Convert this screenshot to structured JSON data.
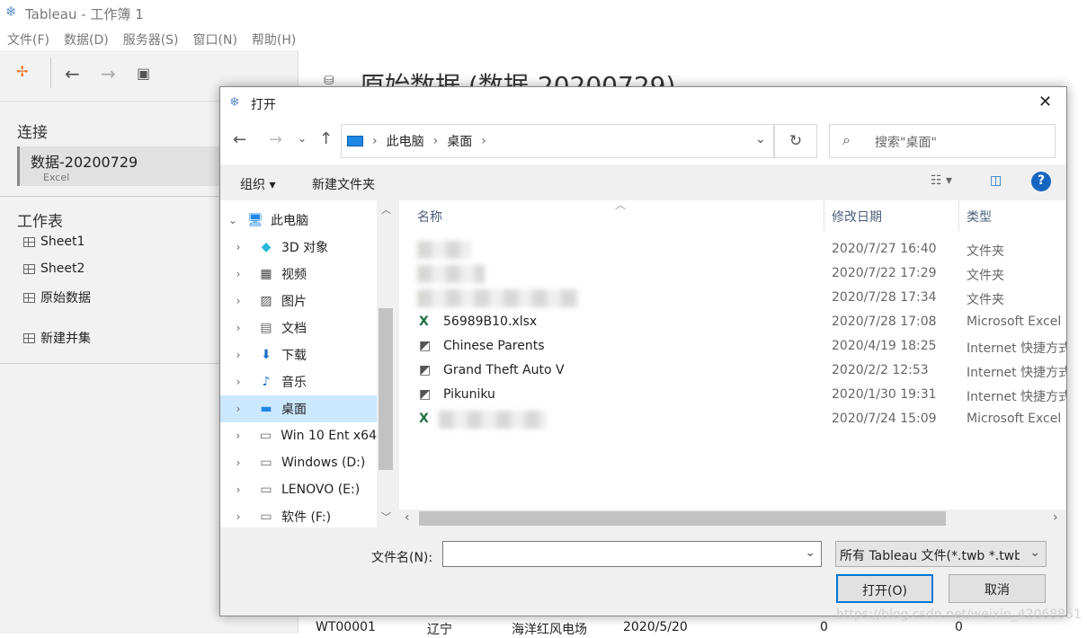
{
  "app": {
    "title": "Tableau - 工作簿 1",
    "menu": [
      "文件(F)",
      "数据(D)",
      "服务器(S)",
      "窗口(N)",
      "帮助(H)"
    ],
    "left": {
      "connections_label": "连接",
      "connection": {
        "name": "数据-20200729",
        "type": "Excel"
      },
      "sheets_label": "工作表",
      "sheets": [
        "Sheet1",
        "Sheet2",
        "原始数据"
      ],
      "new_union": "新建并集"
    },
    "main_title": "原始数据 (数据-20200729)",
    "bg_row": [
      "WT00001",
      "辽宁",
      "海洋红风电场",
      "2020/5/20",
      "0",
      "0"
    ],
    "watermark": "https://blog.csdn.net/weixin_42068851"
  },
  "dialog": {
    "title": "打开",
    "breadcrumb": [
      "此电脑",
      "桌面"
    ],
    "search_placeholder": "搜索\"桌面\"",
    "toolbar": {
      "organize": "组织",
      "new_folder": "新建文件夹"
    },
    "nav": [
      {
        "label": "此电脑",
        "icon": "computer-icon",
        "expanded": true,
        "level": 0
      },
      {
        "label": "3D 对象",
        "icon": "3d-objects-icon",
        "level": 1
      },
      {
        "label": "视频",
        "icon": "video-icon",
        "level": 1
      },
      {
        "label": "图片",
        "icon": "pictures-icon",
        "level": 1
      },
      {
        "label": "文档",
        "icon": "documents-icon",
        "level": 1
      },
      {
        "label": "下载",
        "icon": "download-icon",
        "level": 1
      },
      {
        "label": "音乐",
        "icon": "music-icon",
        "level": 1
      },
      {
        "label": "桌面",
        "icon": "desktop-icon",
        "level": 1,
        "selected": true
      },
      {
        "label": "Win 10 Ent x64",
        "icon": "drive-icon",
        "level": 1
      },
      {
        "label": "Windows (D:)",
        "icon": "drive-icon",
        "level": 1
      },
      {
        "label": "LENOVO (E:)",
        "icon": "drive-icon",
        "level": 1
      },
      {
        "label": "软件 (F:)",
        "icon": "drive-icon",
        "level": 1
      }
    ],
    "columns": [
      "名称",
      "修改日期",
      "类型"
    ],
    "files": [
      {
        "name": "",
        "icon": "folder-icon",
        "date": "2020/7/27 16:40",
        "type": "文件夹",
        "blurred": true
      },
      {
        "name": "",
        "icon": "folder-icon",
        "date": "2020/7/22 17:29",
        "type": "文件夹",
        "blurred": true
      },
      {
        "name": "",
        "icon": "folder-icon",
        "date": "2020/7/28 17:34",
        "type": "文件夹",
        "blurred": true
      },
      {
        "name": "56989B10.xlsx",
        "icon": "excel-icon",
        "date": "2020/7/28 17:08",
        "type": "Microsoft Excel"
      },
      {
        "name": "Chinese Parents",
        "icon": "shortcut-icon",
        "date": "2020/4/19 18:25",
        "type": "Internet 快捷方式"
      },
      {
        "name": "Grand Theft Auto V",
        "icon": "shortcut-icon",
        "date": "2020/2/2 12:53",
        "type": "Internet 快捷方式"
      },
      {
        "name": "Pikuniku",
        "icon": "shortcut-icon",
        "date": "2020/1/30 19:31",
        "type": "Internet 快捷方式"
      },
      {
        "name": "",
        "icon": "excel-icon",
        "date": "2020/7/24 15:09",
        "type": "Microsoft Excel",
        "blurred": true
      }
    ],
    "filename_label": "文件名(N):",
    "filename_value": "",
    "filetype": "所有 Tableau 文件(*.twb *.twbx",
    "open": "打开(O)",
    "cancel": "取消"
  }
}
